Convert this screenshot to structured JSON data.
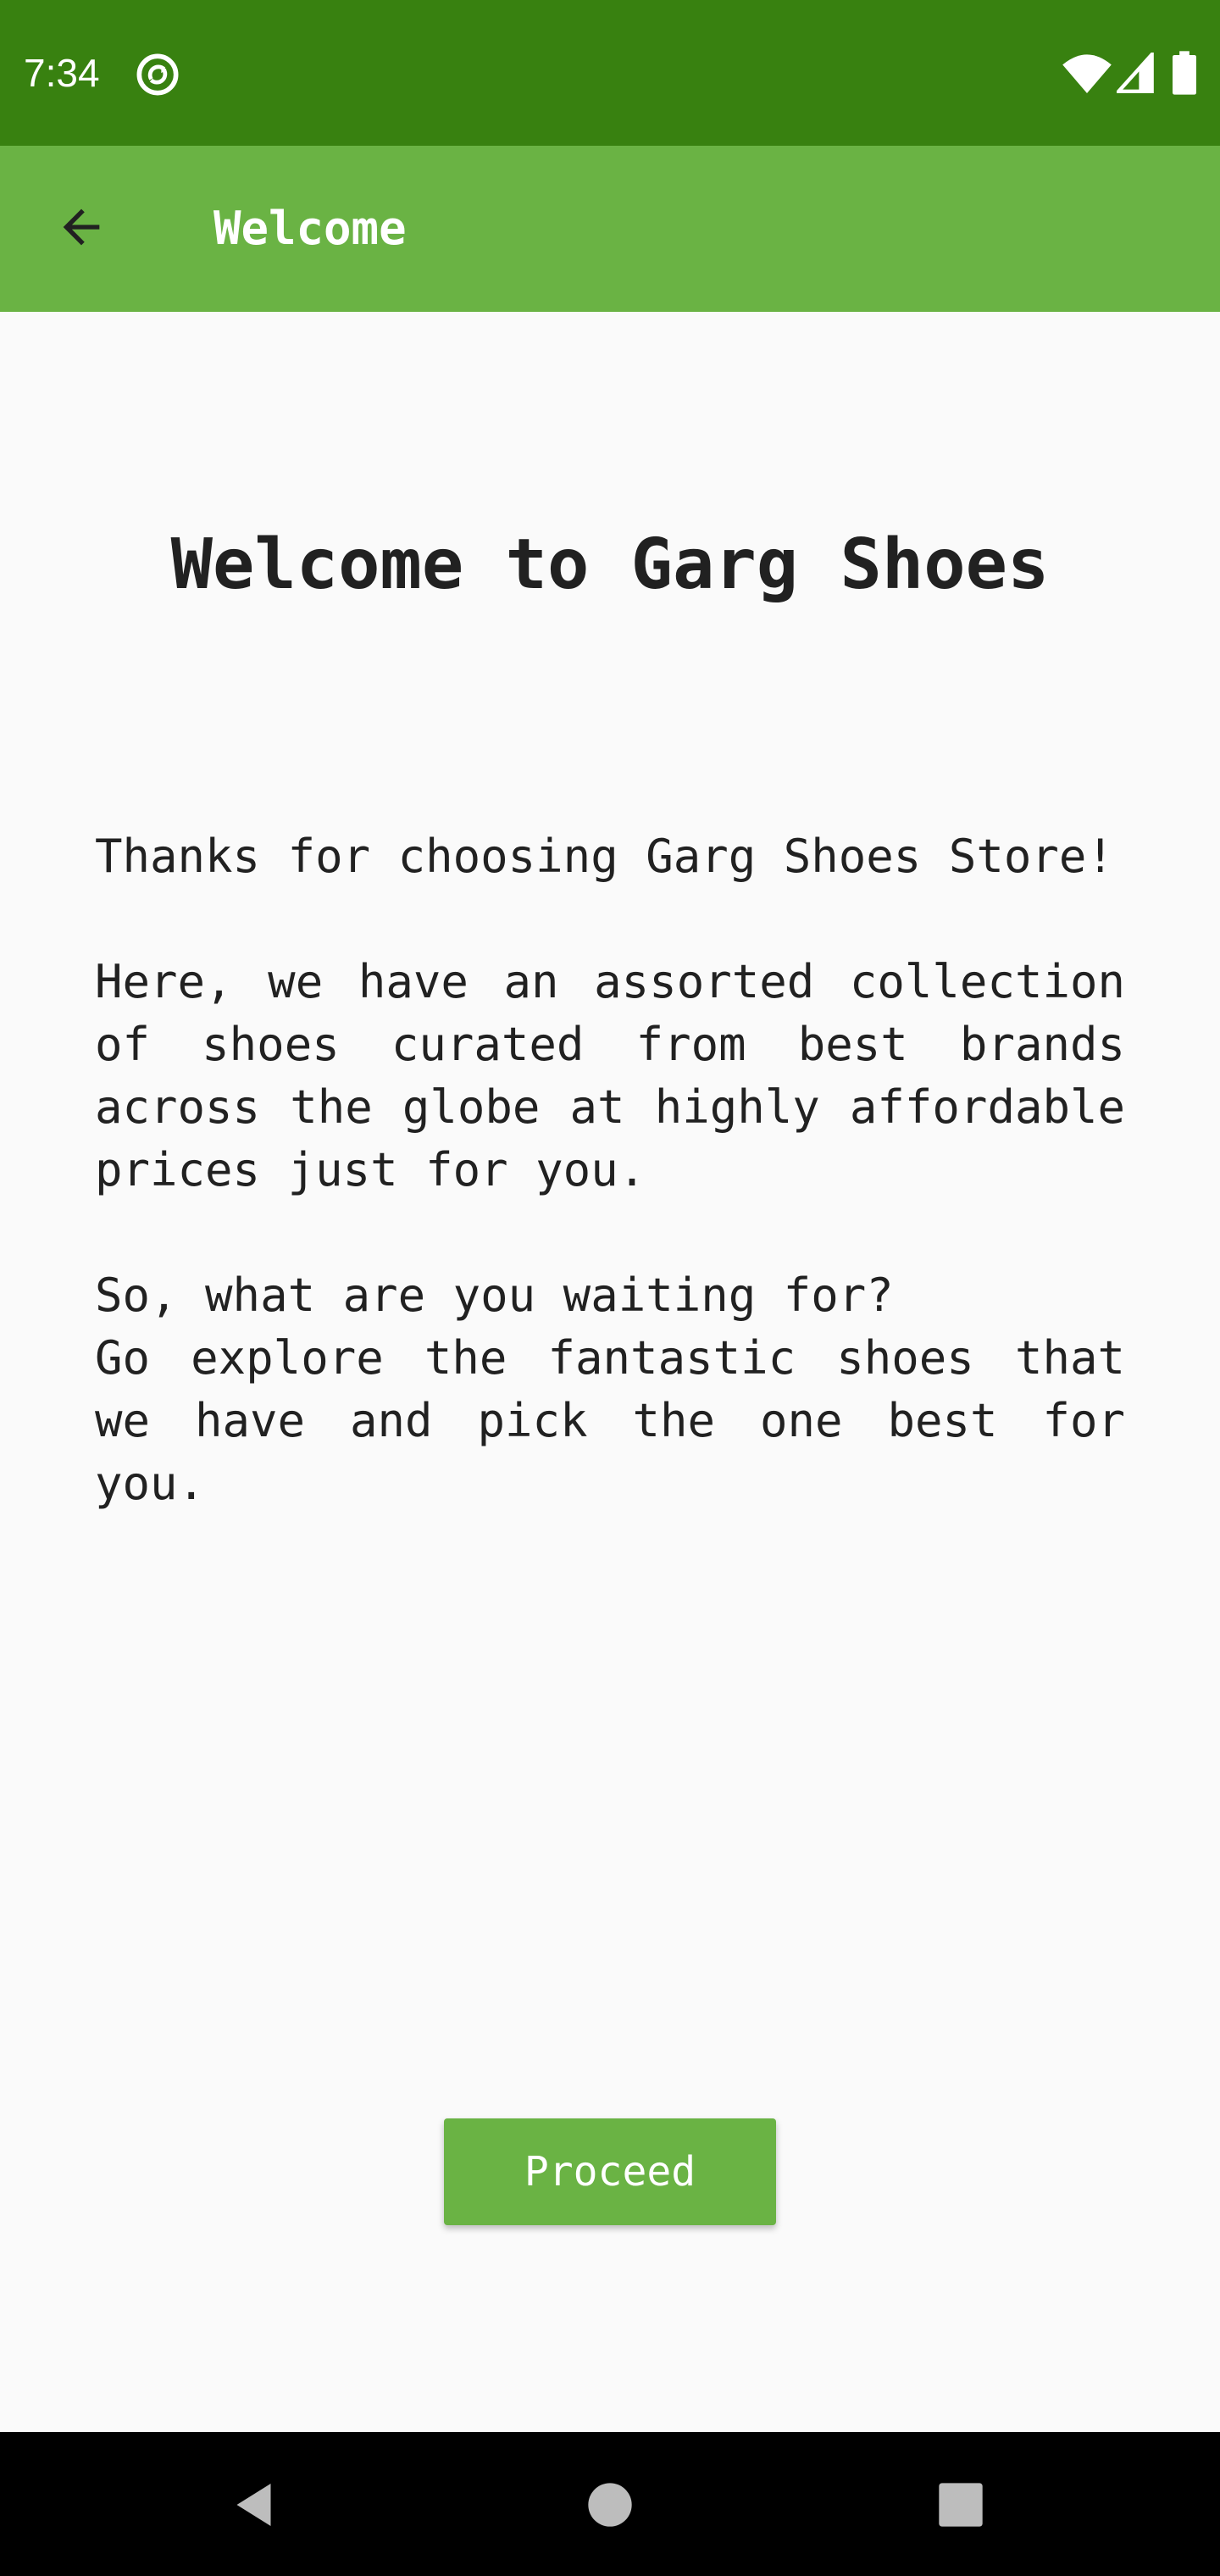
{
  "status_bar": {
    "time": "7:34",
    "icons": [
      "sync-icon",
      "wifi-icon",
      "signal-icon",
      "battery-icon"
    ],
    "background_color": "#388110"
  },
  "app_bar": {
    "back_icon": "arrow-back-icon",
    "title": "Welcome",
    "background_color": "#6ab344"
  },
  "main": {
    "heading": "Welcome to Garg Shoes",
    "paragraphs": [
      "Thanks for choosing Garg Shoes Store!",
      "Here, we have an assorted collection of shoes curated from best brands across the globe at highly affordable prices just for you.",
      "So, what are you waiting for?",
      "Go explore the fantastic shoes that we have and pick the one best for you."
    ],
    "proceed_label": "Proceed",
    "button_color": "#6ab344"
  },
  "nav_bar": {
    "icons": [
      "nav-back-icon",
      "nav-home-icon",
      "nav-recents-icon"
    ]
  }
}
